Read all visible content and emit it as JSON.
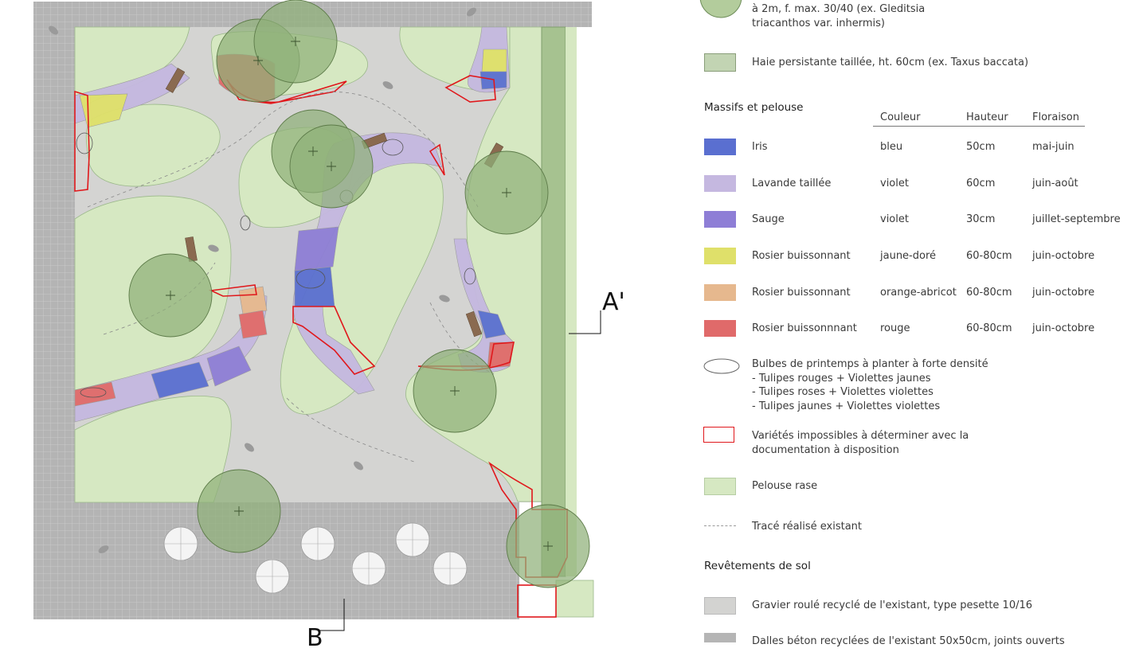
{
  "plan": {
    "section_a": "A'",
    "section_b": "B"
  },
  "legend": {
    "tree_text": "à 2m, f. max. 30/40 (ex. Gleditsia triacanthos var. inhermis)",
    "tree_text_line1": "à 2m, f. max. 30/40 (ex. Gleditsia",
    "tree_text_line2": "triacanthos var. inhermis)",
    "hedge": "Haie persistante taillée, ht. 60cm (ex. Taxus baccata)",
    "massifs_title": "Massifs et pelouse",
    "columns": {
      "color": "Couleur",
      "height": "Hauteur",
      "bloom": "Floraison"
    },
    "plants": [
      {
        "name": "Iris",
        "color": "bleu",
        "height": "50cm",
        "bloom": "mai-juin",
        "swatch": "#5a6fd0"
      },
      {
        "name": "Lavande taillée",
        "color": "violet",
        "height": "60cm",
        "bloom": "juin-août",
        "swatch": "#c5b8e0"
      },
      {
        "name": "Sauge",
        "color": "violet",
        "height": "30cm",
        "bloom": "juillet-septembre",
        "swatch": "#8e7ed6"
      },
      {
        "name": "Rosier buissonnant",
        "color": "jaune-doré",
        "height": "60-80cm",
        "bloom": "juin-octobre",
        "swatch": "#dfe06a"
      },
      {
        "name": "Rosier buissonnant",
        "color": "orange-abricot",
        "height": "60-80cm",
        "bloom": "juin-octobre",
        "swatch": "#e6b88e"
      },
      {
        "name": "Rosier buissonnnant",
        "color": "rouge",
        "height": "60-80cm",
        "bloom": "juin-octobre",
        "swatch": "#e06a6a"
      }
    ],
    "bulbs_title": "Bulbes de printemps à planter à forte densité",
    "bulbs_lines": [
      "- Tulipes rouges + Violettes jaunes",
      "- Tulipes roses + Violettes violettes",
      "- Tulipes jaunes + Violettes violettes"
    ],
    "unknown_line1": "Variétés impossibles à déterminer avec la",
    "unknown_line2": "documentation à disposition",
    "lawn": "Pelouse rase",
    "existing_trace": "Tracé réalisé existant",
    "surfaces_title": "Revêtements de sol",
    "gravel": "Gravier roulé recyclé de l'existant, type pesette 10/16",
    "slabs": "Dalles béton recyclées de l'existant 50x50cm, joints ouverts"
  },
  "colors": {
    "lawn": "#d6e8c2",
    "gravel": "#d3d3d1",
    "pavement": "#b5b5b5",
    "tree": "#8fb078",
    "hedge": "#a6c290",
    "red_outline": "#e0181c"
  }
}
